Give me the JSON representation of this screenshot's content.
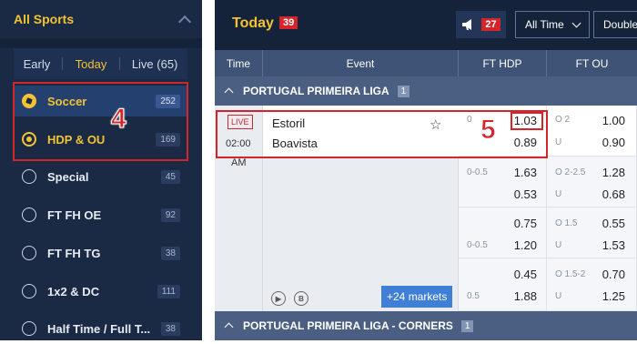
{
  "sidebar": {
    "title": "All Sports",
    "tabs": [
      "Early",
      "Today",
      "Live (65)"
    ],
    "items": [
      {
        "label": "Soccer",
        "count": "252"
      },
      {
        "label": "HDP & OU",
        "count": "169"
      },
      {
        "label": "Special",
        "count": "45"
      },
      {
        "label": "FT FH OE",
        "count": "92"
      },
      {
        "label": "FT FH TG",
        "count": "38"
      },
      {
        "label": "1x2 & DC",
        "count": "111"
      },
      {
        "label": "Half Time / Full T...",
        "count": "38"
      }
    ]
  },
  "annotations": {
    "step4": "4",
    "step5": "5"
  },
  "topbar": {
    "title": "Today",
    "count": "39",
    "bell_count": "27",
    "filter": "All Time",
    "odds_type": "Double"
  },
  "table": {
    "headers": [
      "Time",
      "Event",
      "FT HDP",
      "FT OU"
    ]
  },
  "leagues": [
    {
      "name": "PORTUGAL PRIMEIRA LIGA",
      "count": "1"
    },
    {
      "name": "PORTUGAL PRIMEIRA LIGA - CORNERS",
      "count": "1"
    }
  ],
  "match": {
    "live": "LIVE",
    "time": "02:00",
    "ampm": "AM",
    "home": "Estoril",
    "away": "Boavista",
    "markets": "+24 markets",
    "icons": [
      "play-icon",
      "b-icon"
    ],
    "icon_b": "B"
  },
  "rows": [
    {
      "hdp": "0",
      "hdp_home": "1.03",
      "hdp_away": "0.89",
      "ou": "O 2",
      "ou_u": "U",
      "ou_over": "1.00",
      "ou_under": "0.90"
    },
    {
      "hdp": "0-0.5",
      "hdp_home": "1.63",
      "hdp_away": "0.53",
      "ou": "O 2-2.5",
      "ou_u": "U",
      "ou_over": "1.28",
      "ou_under": "0.68"
    },
    {
      "hdp": "0-0.5",
      "hdp_home": "0.75",
      "hdp_away": "1.20",
      "ou": "O 1.5",
      "ou_u": "U",
      "ou_over": "0.55",
      "ou_under": "1.53"
    },
    {
      "hdp": "0.5",
      "hdp_home": "0.45",
      "hdp_away": "1.88",
      "ou": "O 1.5-2",
      "ou_u": "U",
      "ou_over": "0.70",
      "ou_under": "1.25"
    }
  ]
}
